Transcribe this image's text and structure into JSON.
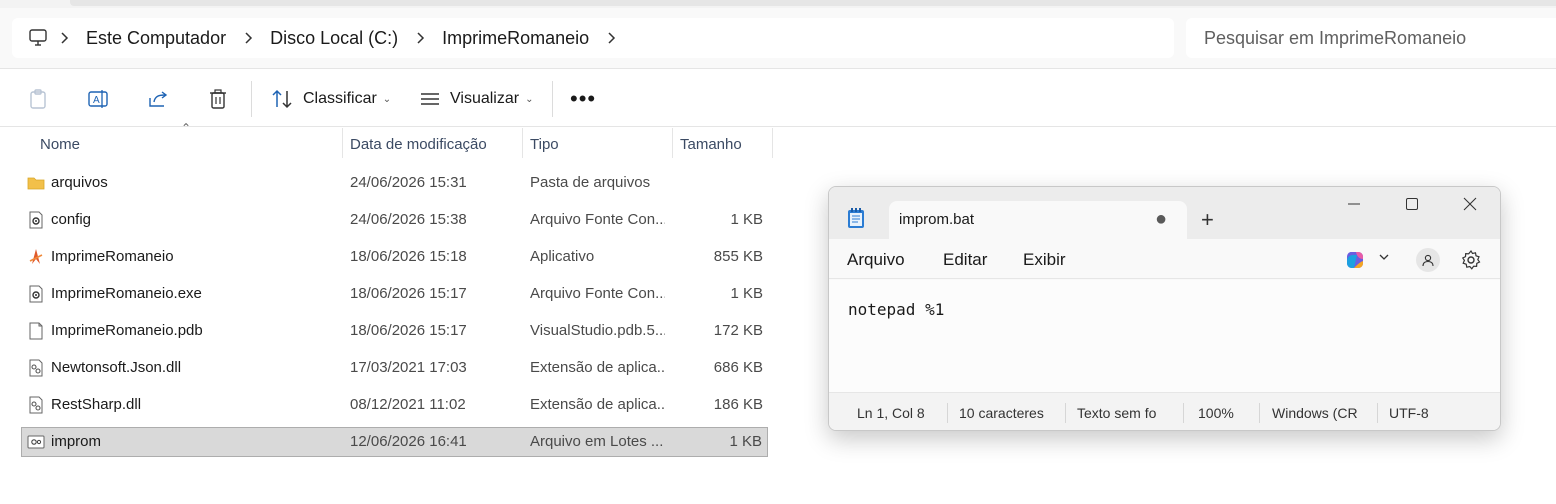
{
  "address_bar": {
    "breadcrumbs": [
      "Este Computador",
      "Disco Local (C:)",
      "ImprimeRomaneio"
    ]
  },
  "search": {
    "placeholder": "Pesquisar em ImprimeRomaneio"
  },
  "command_bar": {
    "sort_label": "Classificar",
    "view_label": "Visualizar",
    "more_label": "•••"
  },
  "columns": {
    "name": "Nome",
    "date": "Data de modificação",
    "type": "Tipo",
    "size": "Tamanho"
  },
  "files": [
    {
      "name": "arquivos",
      "date": "24/06/2026 15:31",
      "type": "Pasta de arquivos",
      "size": "",
      "icon": "folder-icon"
    },
    {
      "name": "config",
      "date": "24/06/2026 15:38",
      "type": "Arquivo Fonte Con...",
      "size": "1 KB",
      "icon": "config-file-icon"
    },
    {
      "name": "ImprimeRomaneio",
      "date": "18/06/2026 15:18",
      "type": "Aplicativo",
      "size": "855 KB",
      "icon": "application-icon"
    },
    {
      "name": "ImprimeRomaneio.exe",
      "date": "18/06/2026 15:17",
      "type": "Arquivo Fonte Con...",
      "size": "1 KB",
      "icon": "config-file-icon"
    },
    {
      "name": "ImprimeRomaneio.pdb",
      "date": "18/06/2026 15:17",
      "type": "VisualStudio.pdb.5...",
      "size": "172 KB",
      "icon": "blank-file-icon"
    },
    {
      "name": "Newtonsoft.Json.dll",
      "date": "17/03/2021 17:03",
      "type": "Extensão de aplica...",
      "size": "686 KB",
      "icon": "dll-file-icon"
    },
    {
      "name": "RestSharp.dll",
      "date": "08/12/2021 11:02",
      "type": "Extensão de aplica...",
      "size": "186 KB",
      "icon": "dll-file-icon"
    },
    {
      "name": "improm",
      "date": "12/06/2026 16:41",
      "type": "Arquivo em Lotes ...",
      "size": "1 KB",
      "icon": "batch-file-icon",
      "selected": true
    }
  ],
  "notepad": {
    "tab_title": "improm.bat",
    "unsaved_indicator": "●",
    "new_tab": "+",
    "menu": [
      "Arquivo",
      "Editar",
      "Exibir"
    ],
    "content": "notepad %1",
    "status": {
      "position": "Ln 1, Col 8",
      "chars": "10 caracteres",
      "format": "Texto sem fo",
      "zoom": "100%",
      "line_ending": "Windows (CR",
      "encoding": "UTF-8"
    }
  },
  "colors": {
    "accent_blue": "#1e63b4",
    "selected_row": "#d9d9d9",
    "folder_yellow": "#f2c04a"
  }
}
